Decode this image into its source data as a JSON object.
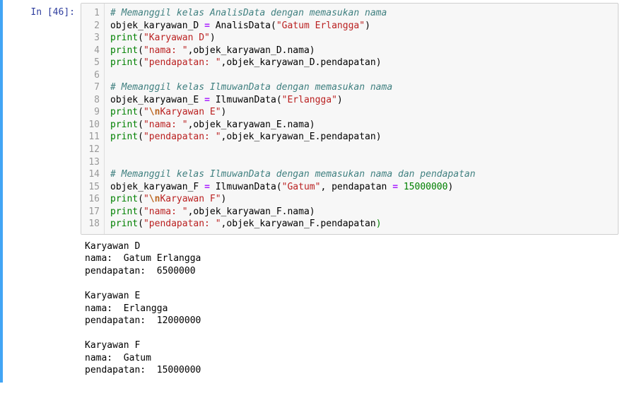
{
  "prompt": "In [46]:",
  "lineNumbers": [
    "1",
    "2",
    "3",
    "4",
    "5",
    "6",
    "7",
    "8",
    "9",
    "10",
    "11",
    "12",
    "13",
    "14",
    "15",
    "16",
    "17",
    "18"
  ],
  "code": {
    "l1": {
      "comment": "# Memanggil kelas AnalisData dengan memasukan nama"
    },
    "l2": {
      "lhs": "objek_karyawan_D ",
      "eq": "=",
      "sp": " ",
      "cls": "AnalisData",
      "arg": "\"Gatum Erlangga\""
    },
    "l3": {
      "fn": "print",
      "arg": "\"Karyawan D\""
    },
    "l4": {
      "fn": "print",
      "s": "\"nama: \"",
      "rest": ",objek_karyawan_D.nama"
    },
    "l5": {
      "fn": "print",
      "s": "\"pendapatan: \"",
      "rest": ",objek_karyawan_D.pendapatan"
    },
    "l7": {
      "comment": "# Memanggil kelas IlmuwanData dengan memasukan nama"
    },
    "l8": {
      "lhs": "objek_karyawan_E ",
      "eq": "=",
      "sp": " ",
      "cls": "IlmuwanData",
      "arg": "\"Erlangga\""
    },
    "l9": {
      "fn": "print",
      "pre": "\"",
      "esc": "\\n",
      "post": "Karyawan E\""
    },
    "l10": {
      "fn": "print",
      "s": "\"nama: \"",
      "rest": ",objek_karyawan_E.nama"
    },
    "l11": {
      "fn": "print",
      "s": "\"pendapatan: \"",
      "rest": ",objek_karyawan_E.pendapatan"
    },
    "l14": {
      "comment": "# Memanggil kelas IlmuwanData dengan memasukan nama dan pendapatan"
    },
    "l15": {
      "lhs": "objek_karyawan_F ",
      "eq": "=",
      "sp": " ",
      "cls": "IlmuwanData",
      "arg1": "\"Gatum\"",
      "mid": ", pendapatan ",
      "eq2": "=",
      "sp2": " ",
      "num": "15000000"
    },
    "l16": {
      "fn": "print",
      "pre": "\"",
      "esc": "\\n",
      "post": "Karyawan F\""
    },
    "l17": {
      "fn": "print",
      "s": "\"nama: \"",
      "rest": ",objek_karyawan_F.nama"
    },
    "l18": {
      "fn": "print",
      "s": "\"pendapatan: \"",
      "rest": ",objek_karyawan_F.pendapatan"
    }
  },
  "output": "Karyawan D\nnama:  Gatum Erlangga\npendapatan:  6500000\n\nKaryawan E\nnama:  Erlangga\npendapatan:  12000000\n\nKaryawan F\nnama:  Gatum\npendapatan:  15000000"
}
